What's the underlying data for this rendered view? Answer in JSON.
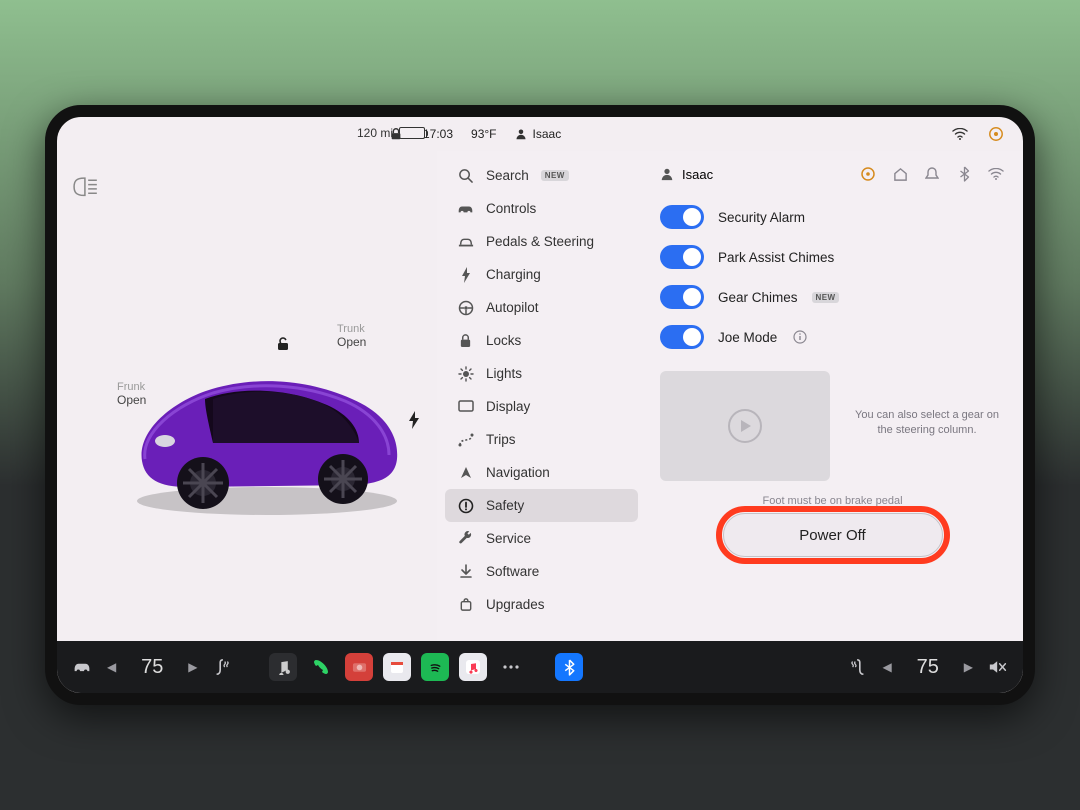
{
  "status": {
    "range": "120 mi",
    "time": "17:03",
    "temp": "93°F",
    "user": "Isaac"
  },
  "car": {
    "frunk_label": "Frunk",
    "frunk_state": "Open",
    "trunk_label": "Trunk",
    "trunk_state": "Open"
  },
  "menu": {
    "search": "Search",
    "search_badge": "NEW",
    "controls": "Controls",
    "pedals": "Pedals & Steering",
    "charging": "Charging",
    "autopilot": "Autopilot",
    "locks": "Locks",
    "lights": "Lights",
    "display": "Display",
    "trips": "Trips",
    "navigation": "Navigation",
    "safety": "Safety",
    "service": "Service",
    "software": "Software",
    "upgrades": "Upgrades"
  },
  "detail": {
    "user": "Isaac",
    "toggles": {
      "security": "Security Alarm",
      "park": "Park Assist Chimes",
      "gear": "Gear Chimes",
      "gear_badge": "NEW",
      "joe": "Joe Mode"
    },
    "gear_help": "You can also select a gear on the steering column.",
    "brake_note": "Foot must be on brake pedal",
    "power_off": "Power Off"
  },
  "dock": {
    "temp_left": "75",
    "temp_right": "75"
  }
}
